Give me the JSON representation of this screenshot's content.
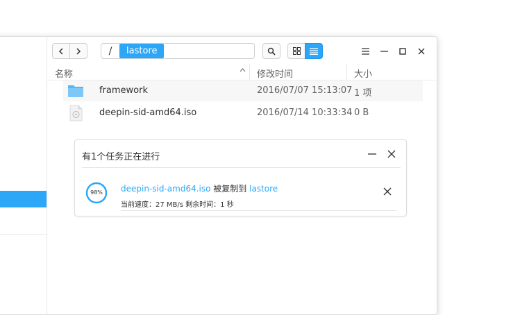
{
  "toolbar": {
    "path_root": "/",
    "path_current": "lastore"
  },
  "columns": {
    "name": "名称",
    "modified": "修改时间",
    "size": "大小"
  },
  "files": [
    {
      "icon": "folder-icon",
      "name": "framework",
      "modified": "2016/07/07 15:13:07",
      "size": "1 项"
    },
    {
      "icon": "iso-file-icon",
      "name": "deepin-sid-amd64.iso",
      "modified": "2016/07/14 10:33:34",
      "size": "0 B"
    }
  ],
  "task": {
    "title": "有1个任务正在进行",
    "progress_percent": 98,
    "progress_label": "98%",
    "file": "deepin-sid-amd64.iso",
    "action": " 被复制到 ",
    "destination": "lastore",
    "status": "当前速度：27 MB/s 剩余时间：1 秒"
  },
  "colors": {
    "accent": "#2ca7f8"
  }
}
